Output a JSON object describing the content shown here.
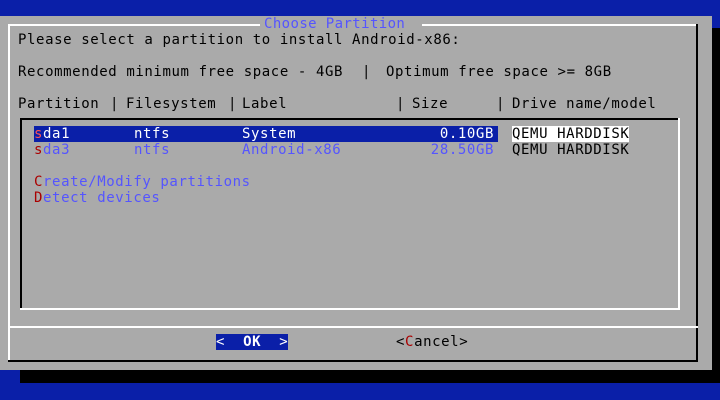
{
  "dialog": {
    "title": "Choose Partition",
    "prompt": "Please select a partition to install Android-x86:",
    "space_info": {
      "recommended": "Recommended minimum free space - 4GB",
      "separator": "|",
      "optimum": "Optimum free space >= 8GB"
    },
    "columns": {
      "partition": "Partition",
      "filesystem": "Filesystem",
      "label": "Label",
      "size": "Size",
      "drive": "Drive name/model",
      "separator": "|"
    },
    "partitions": [
      {
        "hotkey": "s",
        "rest": "da1",
        "filesystem": "ntfs",
        "label": "System",
        "size": "0.10GB",
        "drive": "QEMU HARDDISK",
        "selected": true
      },
      {
        "hotkey": "s",
        "rest": "da3",
        "filesystem": "ntfs",
        "label": "Android-x86",
        "size": "28.50GB",
        "drive": "QEMU HARDDISK",
        "selected": false
      }
    ],
    "actions": [
      {
        "hotkey": "C",
        "rest": "reate/Modify partitions"
      },
      {
        "hotkey": "D",
        "rest": "etect devices"
      }
    ],
    "buttons": {
      "ok": {
        "left": "<",
        "label": "OK",
        "right": ">"
      },
      "cancel": {
        "left": "<",
        "hotkey": "C",
        "rest": "ancel",
        "right": ">"
      }
    }
  },
  "colors": {
    "background": "#0a1fa8",
    "dialog": "#aaaaaa",
    "highlight": "#0a1fa8",
    "hotkey": "#aa0000",
    "inactive_text": "#5555ff"
  }
}
